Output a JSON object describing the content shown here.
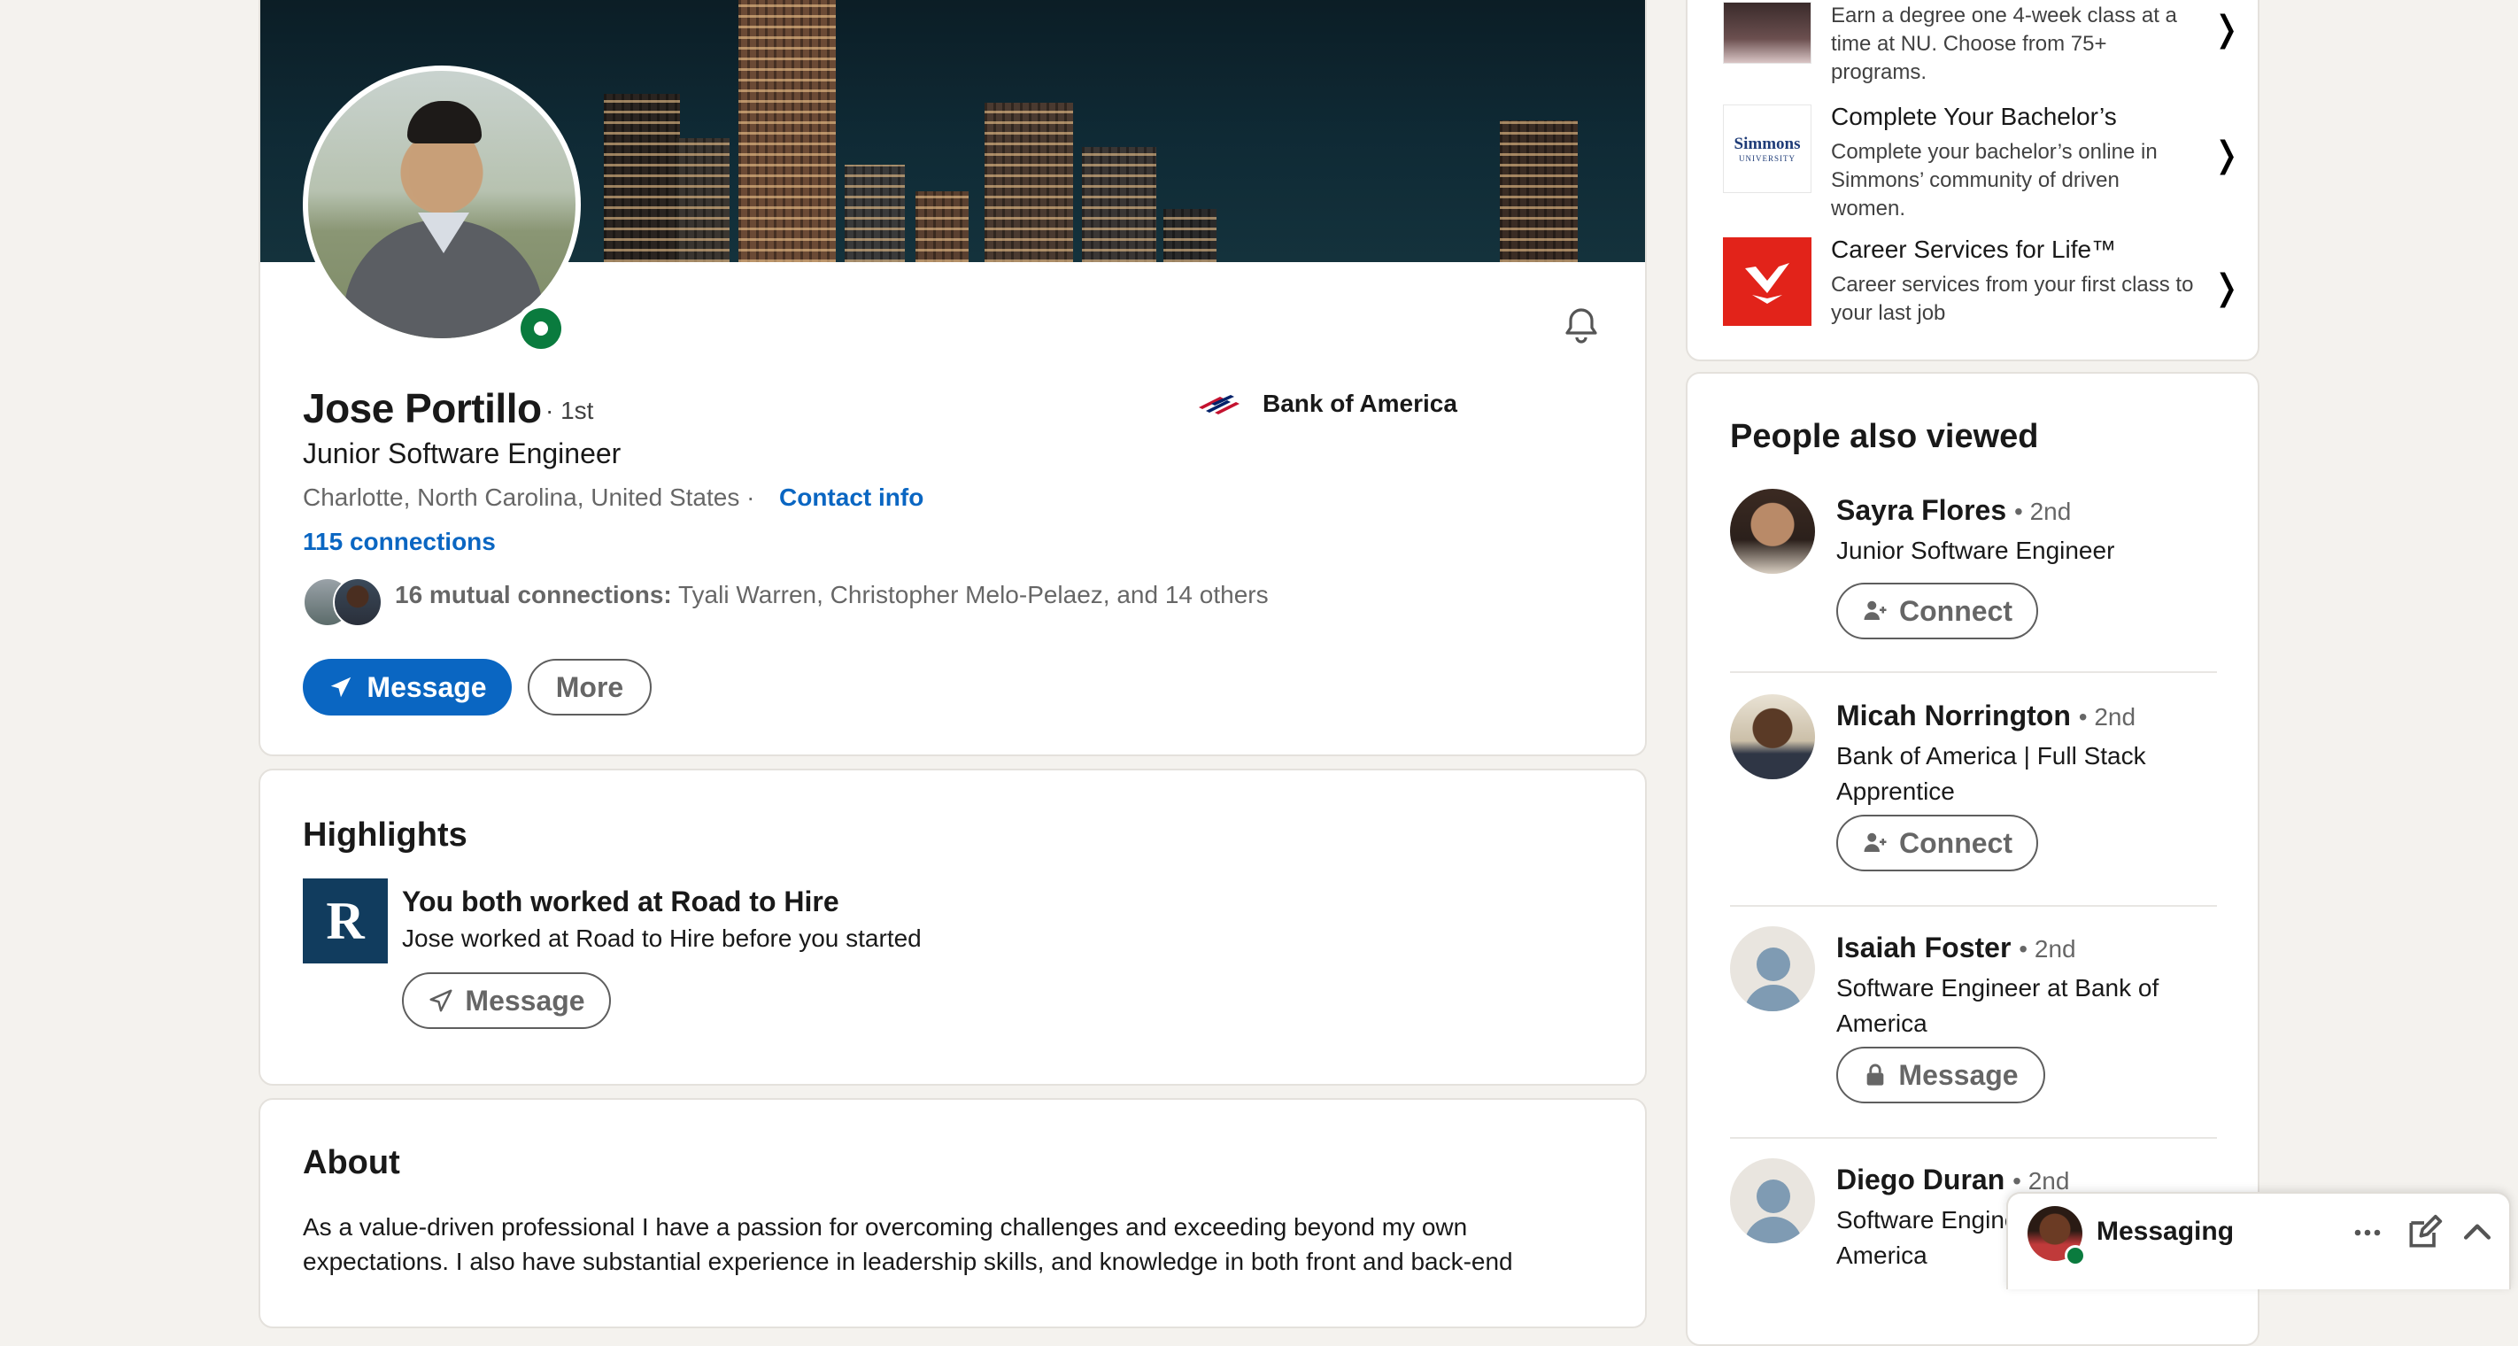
{
  "profile": {
    "name": "Jose Portillo",
    "degree": "· 1st",
    "headline": "Junior Software Engineer",
    "location": "Charlotte, North Carolina, United States ·",
    "contact_info": "Contact info",
    "connections": "115 connections",
    "mutual_bold": "16 mutual connections:",
    "mutual_names": "Tyali Warren, Christopher Melo-Pelaez, and 14 others",
    "company": "Bank of America",
    "message_button": "Message",
    "more_button": "More"
  },
  "highlights": {
    "title": "Highlights",
    "logo_letter": "R",
    "item_title": "You both worked at Road to Hire",
    "item_sub": "Jose worked at Road to Hire before you started",
    "message_button": "Message"
  },
  "about": {
    "title": "About",
    "text": "As a value-driven professional I have a passion for overcoming challenges and exceeding beyond my own expectations. I also have substantial experience in leadership skills, and knowledge in both front and back-end"
  },
  "ads": [
    {
      "title": "",
      "desc": "Earn a degree one 4-week class at a time at NU. Choose from 75+ programs."
    },
    {
      "title": "Complete Your Bachelor’s",
      "desc": "Complete your bachelor’s online in Simmons’ community of driven women.",
      "logo_text": "Simmons UNIVERSITY"
    },
    {
      "title": "Career Services for Life™",
      "desc": "Career services from your first class to your last job"
    }
  ],
  "people_also_viewed": {
    "title": "People also viewed",
    "people": [
      {
        "name": "Sayra Flores",
        "degree": "• 2nd",
        "headline": "Junior Software Engineer",
        "action": "Connect",
        "action_icon": "add-person-icon"
      },
      {
        "name": "Micah Norrington",
        "degree": "• 2nd",
        "headline": "Bank of America | Full Stack Apprentice",
        "action": "Connect",
        "action_icon": "add-person-icon"
      },
      {
        "name": "Isaiah Foster",
        "degree": "• 2nd",
        "headline": "Software Engineer at Bank of America",
        "action": "Message",
        "action_icon": "lock-icon"
      },
      {
        "name": "Diego Duran",
        "degree": "• 2nd",
        "headline": "Software Engineer at Bank of America",
        "action": "",
        "action_icon": ""
      }
    ]
  },
  "messaging": {
    "label": "Messaging"
  },
  "colors": {
    "brand_blue": "#0a66c2",
    "online_green": "#0a7b3e",
    "background": "#f4f2ee"
  }
}
